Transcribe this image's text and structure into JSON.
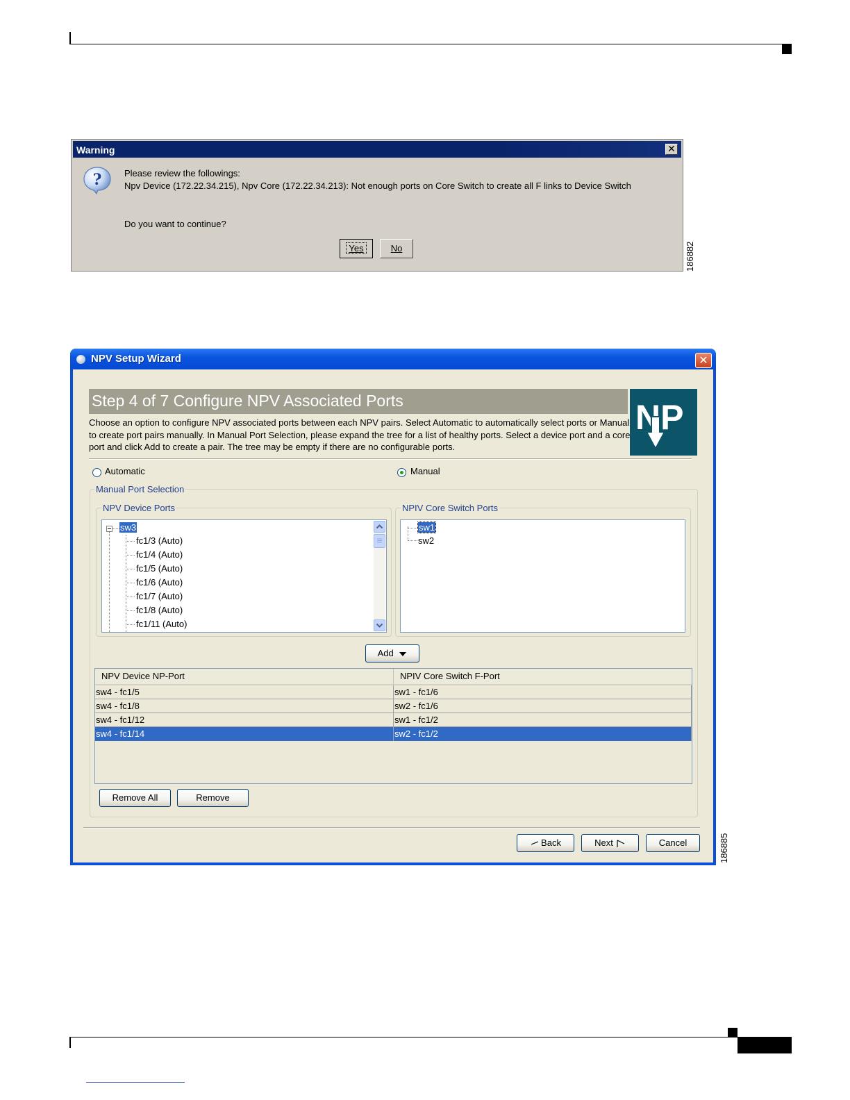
{
  "warning_dialog": {
    "title": "Warning",
    "close_glyph": "✕",
    "line1": "Please review the followings:",
    "line2": "Npv Device (172.22.34.215), Npv Core (172.22.34.213): Not enough ports on Core Switch to create all F links to Device Switch",
    "question": "Do you want to continue?",
    "yes_label": "Yes",
    "no_label": "No",
    "figure_id": "186882",
    "icon": "question-icon"
  },
  "wizard": {
    "title": "NPV Setup Wizard",
    "close_glyph": "✕",
    "step_title": "Step 4 of 7 Configure NPV Associated Ports",
    "description": "Choose an option to configure NPV associated ports between each NPV pairs.  Select Automatic to automatically select ports or Manual to create port pairs manually.  In Manual Port Selection, please expand the tree for a list of healthy ports.  Select a device port and a core port and click Add to create a pair.  The tree may be empty if there are no configurable ports.",
    "logo_text": "NP",
    "radio_automatic": "Automatic",
    "radio_manual": "Manual",
    "selected_mode": "Manual",
    "manual_group_label": "Manual Port Selection",
    "device_ports": {
      "label": "NPV Device Ports",
      "root": "sw3",
      "items": [
        "fc1/3 (Auto)",
        "fc1/4 (Auto)",
        "fc1/5 (Auto)",
        "fc1/6 (Auto)",
        "fc1/7 (Auto)",
        "fc1/8 (Auto)",
        "fc1/11 (Auto)"
      ]
    },
    "core_ports": {
      "label": "NPIV Core Switch Ports",
      "items": [
        "sw1",
        "sw2"
      ],
      "selected": "sw1"
    },
    "add_label": "Add",
    "table": {
      "columns": [
        "NPV Device NP-Port",
        "NPIV Core Switch F-Port"
      ],
      "rows": [
        [
          "sw4 - fc1/5",
          "sw1 - fc1/6"
        ],
        [
          "sw4 - fc1/8",
          "sw2 - fc1/6"
        ],
        [
          "sw4 - fc1/12",
          "sw1 - fc1/2"
        ],
        [
          "sw4 - fc1/14",
          "sw2 - fc1/2"
        ]
      ],
      "selected_row": 3
    },
    "remove_all_label": "Remove All",
    "remove_label": "Remove",
    "back_label": "Back",
    "next_label": "Next",
    "cancel_label": "Cancel",
    "figure_id": "186885"
  },
  "colors": {
    "xp_title_blue": "#0549d2",
    "classic_title_navy": "#0a246a",
    "selection_blue": "#316ac5",
    "banner_gray": "#a09e8e",
    "logo_teal": "#0c5569",
    "dialog_face": "#ece9d8"
  }
}
